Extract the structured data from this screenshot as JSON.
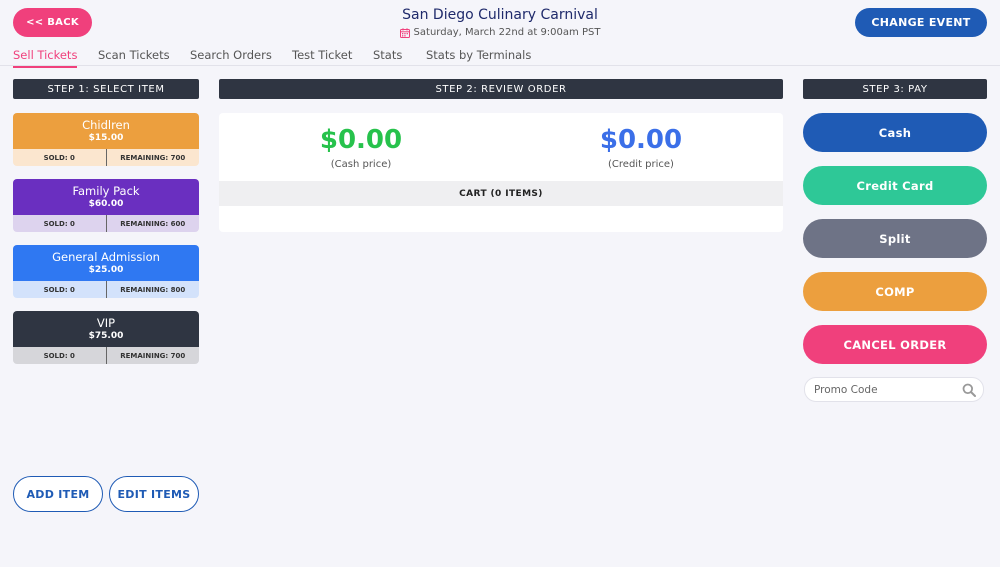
{
  "header": {
    "back_label": "<< BACK",
    "event_title": "San Diego Culinary Carnival",
    "event_date": "Saturday, March 22nd at 9:00am PST",
    "change_event_label": "CHANGE EVENT"
  },
  "nav": {
    "tabs": [
      {
        "label": "Sell Tickets",
        "active": true
      },
      {
        "label": "Scan Tickets"
      },
      {
        "label": "Search Orders"
      },
      {
        "label": "Test Ticket"
      },
      {
        "label": "Stats"
      },
      {
        "label": "Stats by Terminals"
      }
    ]
  },
  "step1": {
    "header": "STEP 1: SELECT ITEM",
    "items": [
      {
        "name": "Chidlren",
        "price": "$15.00",
        "sold": "SOLD: 0",
        "remaining": "REMAINING: 700",
        "color": "#ec9f3e",
        "bottom_color": "#fbe6cf"
      },
      {
        "name": "Family Pack",
        "price": "$60.00",
        "sold": "SOLD: 0",
        "remaining": "REMAINING: 600",
        "color": "#6a2fc0",
        "bottom_color": "#ddd3ee"
      },
      {
        "name": "General Admission",
        "price": "$25.00",
        "sold": "SOLD: 0",
        "remaining": "REMAINING: 800",
        "color": "#2f78f2",
        "bottom_color": "#d3e2fb"
      },
      {
        "name": "VIP",
        "price": "$75.00",
        "sold": "SOLD: 0",
        "remaining": "REMAINING: 700",
        "color": "#2f3542",
        "bottom_color": "#d6d6da"
      }
    ],
    "add_item_label": "ADD ITEM",
    "edit_items_label": "EDIT ITEMS"
  },
  "step2": {
    "header": "STEP 2: REVIEW ORDER",
    "cash_price": "$0.00",
    "cash_label": "(Cash price)",
    "credit_price": "$0.00",
    "credit_label": "(Credit price)",
    "cart_label": "CART (0 ITEMS)"
  },
  "step3": {
    "header": "STEP 3: PAY",
    "buttons": [
      {
        "label": "Cash",
        "color": "#1f5bb5"
      },
      {
        "label": "Credit Card",
        "color": "#2ec897"
      },
      {
        "label": "Split",
        "color": "#6e7386"
      },
      {
        "label": "COMP",
        "color": "#ec9f3e"
      },
      {
        "label": "CANCEL ORDER",
        "color": "#f0407c"
      }
    ],
    "promo_placeholder": "Promo Code"
  },
  "colors": {
    "accent_pink": "#f0407c",
    "primary_blue": "#1f5bb5",
    "cash_green": "#27c24c",
    "credit_blue": "#3b6fe8"
  }
}
